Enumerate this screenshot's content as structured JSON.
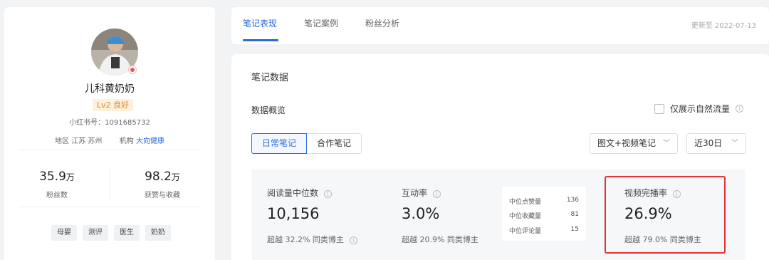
{
  "profile": {
    "name": "儿科黄奶奶",
    "level": "Lv2 良好",
    "xhs_id": "小红书号：1091685732",
    "region_label": "地区",
    "region_value": "江苏 苏州",
    "org_label": "机构",
    "org_value": "大向健康",
    "stats": [
      {
        "value": "35.9",
        "unit": "万",
        "label": "粉丝数"
      },
      {
        "value": "98.2",
        "unit": "万",
        "label": "获赞与收藏"
      }
    ],
    "tags": [
      "母婴",
      "测评",
      "医生",
      "奶奶"
    ]
  },
  "tabs": {
    "items": [
      "笔记表现",
      "笔记案例",
      "粉丝分析"
    ],
    "active_index": 0,
    "updated": "更新至 2022-07-13"
  },
  "main": {
    "section_title": "笔记数据",
    "overview_title": "数据概览",
    "natural_traffic_label": "仅展示自然流量",
    "natural_traffic_checked": false,
    "note_types": [
      "日常笔记",
      "合作笔记"
    ],
    "note_type_active": 0,
    "content_filter": "图文+视频笔记",
    "period_filter": "近30日",
    "metrics": [
      {
        "label": "阅读量中位数",
        "value": "10,156",
        "foot": "超越 32.2% 同类博主"
      },
      {
        "label": "互动率",
        "value": "3.0%",
        "foot": "超越 20.9% 同类博主"
      },
      {
        "label": "视频完播率",
        "value": "26.9%",
        "foot": "超越 79.0% 同类博主"
      }
    ],
    "interaction_breakdown": [
      {
        "label": "中位点赞量",
        "value": "136"
      },
      {
        "label": "中位收藏量",
        "value": "81"
      },
      {
        "label": "中位评论量",
        "value": "15"
      }
    ]
  },
  "colors": {
    "accent": "#2d6bd8",
    "highlight_box": "#e23434",
    "level_badge": "#e08a1e"
  }
}
